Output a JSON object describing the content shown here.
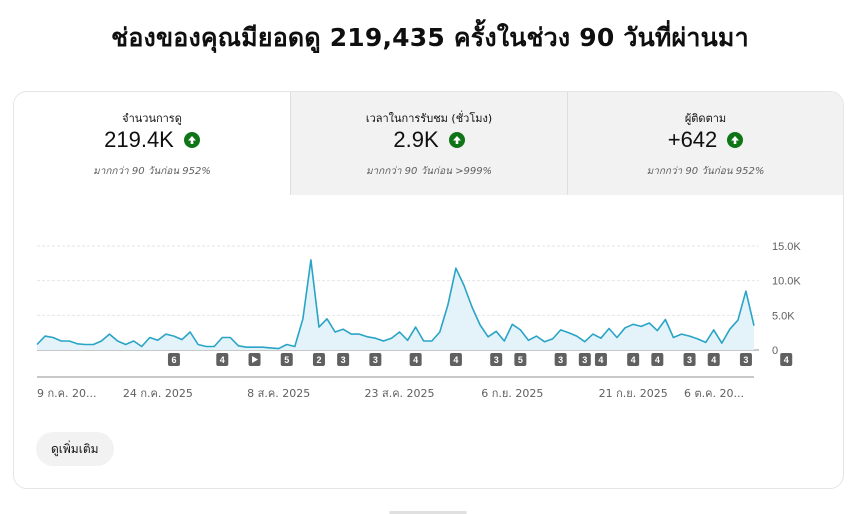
{
  "headline": "ช่องของคุณมียอดดู 219,435 ครั้งในช่วง 90 วันที่ผ่านมา",
  "tabs": [
    {
      "label": "จำนวนการดู",
      "value": "219.4K",
      "note": "มากกว่า 90 วันก่อน 952%"
    },
    {
      "label": "เวลาในการรับชม (ชั่วโมง)",
      "value": "2.9K",
      "note": "มากกว่า 90 วันก่อน >999%"
    },
    {
      "label": "ผู้ติดตาม",
      "value": "+642",
      "note": "มากกว่า 90 วันก่อน 952%"
    }
  ],
  "more_button": "ดูเพิ่มเติม",
  "colors": {
    "line": "#2aa4c6",
    "fill": "#e3f3f9",
    "up_badge": "#107516",
    "marker_bg": "#606060"
  },
  "chart_data": {
    "type": "area",
    "y_ticks": [
      "15.0K",
      "10.0K",
      "5.0K",
      "0"
    ],
    "y_tick_values": [
      15000,
      10000,
      5000,
      0
    ],
    "ylim": [
      0,
      15000
    ],
    "x_tick_labels": [
      "9 ก.ค. 20...",
      "24 ก.ค. 2025",
      "8 ส.ค. 2025",
      "23 ส.ค. 2025",
      "6 ก.ย. 2025",
      "21 ก.ย. 2025",
      "6 ต.ค. 20..."
    ],
    "x_tick_days": [
      1,
      16,
      31,
      46,
      60,
      75,
      90
    ],
    "grid": true,
    "series": [
      {
        "values": [
          800,
          2000,
          1800,
          1300,
          1300,
          900,
          800,
          800,
          1300,
          2300,
          1300,
          800,
          1300,
          500,
          1800,
          1400,
          2300,
          2000,
          1500,
          2600,
          800,
          500,
          500,
          1800,
          1800,
          600,
          400,
          400,
          400,
          300,
          200,
          800,
          500,
          4500,
          13000,
          3300,
          4500,
          2600,
          3000,
          2300,
          2300,
          1900,
          1700,
          1300,
          1700,
          2600,
          1400,
          3300,
          1300,
          1300,
          2600,
          6500,
          11800,
          9300,
          6200,
          3600,
          1900,
          2700,
          1300,
          3700,
          2900,
          1400,
          2000,
          1200,
          1600,
          2900,
          2500,
          2000,
          1200,
          2300,
          1700,
          3100,
          1800,
          3200,
          3700,
          3400,
          3900,
          2800,
          4400,
          1800,
          2300,
          2000,
          1600,
          1100,
          2900,
          1000,
          3000,
          4300,
          8500,
          3500
        ]
      }
    ],
    "markers": [
      {
        "label": "6",
        "day": 18
      },
      {
        "label": "4",
        "day": 24
      },
      {
        "label": "play",
        "day": 28
      },
      {
        "label": "5",
        "day": 32
      },
      {
        "label": "2",
        "day": 36
      },
      {
        "label": "3",
        "day": 39
      },
      {
        "label": "3",
        "day": 43
      },
      {
        "label": "4",
        "day": 48
      },
      {
        "label": "4",
        "day": 53
      },
      {
        "label": "3",
        "day": 58
      },
      {
        "label": "5",
        "day": 61
      },
      {
        "label": "3",
        "day": 66
      },
      {
        "label": "3",
        "day": 69
      },
      {
        "label": "4",
        "day": 71
      },
      {
        "label": "4",
        "day": 75
      },
      {
        "label": "4",
        "day": 78
      },
      {
        "label": "3",
        "day": 82
      },
      {
        "label": "4",
        "day": 85
      },
      {
        "label": "3",
        "day": 89
      },
      {
        "label": "4",
        "day": 94
      }
    ]
  }
}
